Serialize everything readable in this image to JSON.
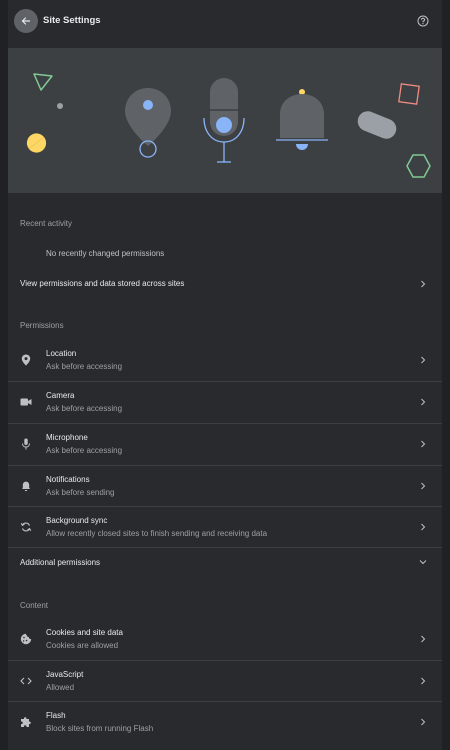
{
  "header": {
    "title": "Site Settings"
  },
  "recent": {
    "label": "Recent activity",
    "empty": "No recently changed permissions",
    "view_all": "View permissions and data stored across sites"
  },
  "permissions": {
    "label": "Permissions",
    "items": [
      {
        "title": "Location",
        "sub": "Ask before accessing"
      },
      {
        "title": "Camera",
        "sub": "Ask before accessing"
      },
      {
        "title": "Microphone",
        "sub": "Ask before accessing"
      },
      {
        "title": "Notifications",
        "sub": "Ask before sending"
      },
      {
        "title": "Background sync",
        "sub": "Allow recently closed sites to finish sending and receiving data"
      }
    ],
    "additional": "Additional permissions"
  },
  "content": {
    "label": "Content",
    "items": [
      {
        "title": "Cookies and site data",
        "sub": "Cookies are allowed"
      },
      {
        "title": "JavaScript",
        "sub": "Allowed"
      },
      {
        "title": "Flash",
        "sub": "Block sites from running Flash"
      }
    ]
  }
}
